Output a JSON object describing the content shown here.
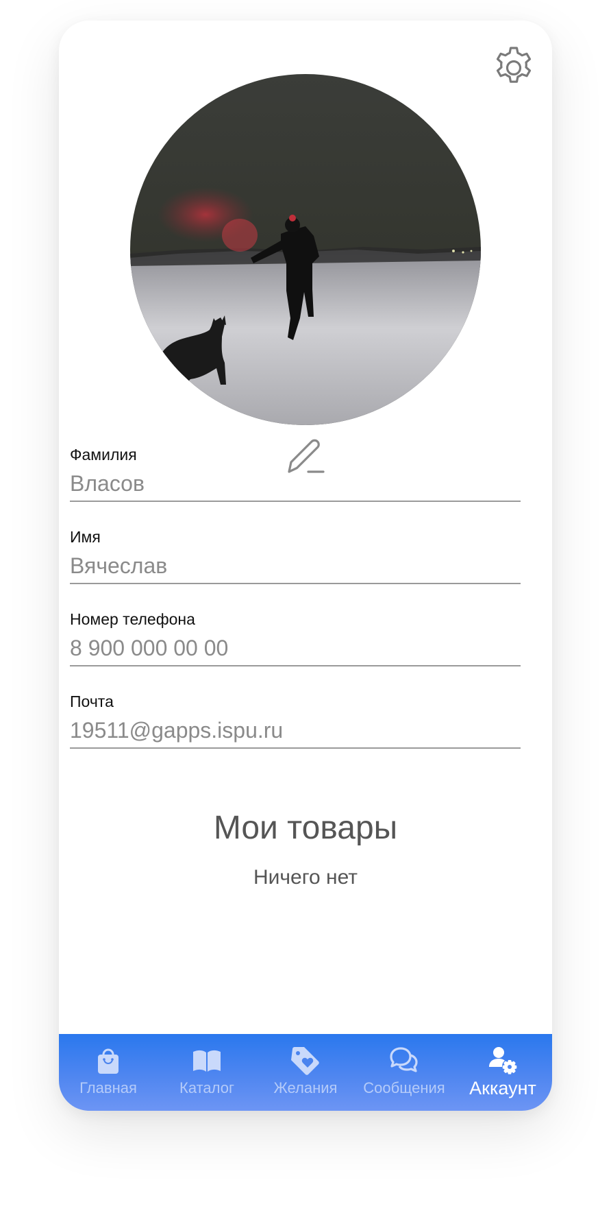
{
  "profile": {
    "photo_alt": "аватар пользователя"
  },
  "fields": [
    {
      "label": "Фамилия",
      "placeholder": "Власов"
    },
    {
      "label": "Имя",
      "placeholder": "Вячеслав"
    },
    {
      "label": "Номер телефона",
      "placeholder": "8 900 000 00 00"
    },
    {
      "label": "Почта",
      "placeholder": "19511@gapps.ispu.ru"
    }
  ],
  "products": {
    "title": "Мои товары",
    "empty_text": "Ничего нет"
  },
  "nav": {
    "items": [
      {
        "label": "Главная",
        "icon": "shopping-bag-icon",
        "active": false
      },
      {
        "label": "Каталог",
        "icon": "book-icon",
        "active": false
      },
      {
        "label": "Желания",
        "icon": "heart-tag-icon",
        "active": false
      },
      {
        "label": "Сообщения",
        "icon": "chat-bubbles-icon",
        "active": false
      },
      {
        "label": "Аккаунт",
        "icon": "user-gear-icon",
        "active": true
      }
    ]
  },
  "colors": {
    "nav_background": "#3a7ff0",
    "nav_inactive": "#c9d9fb",
    "nav_active": "#ffffff",
    "field_text": "#8a8a8a",
    "label_text": "#111111",
    "heading_text": "#555555"
  },
  "icons": {
    "settings": "gear-icon",
    "edit": "pencil-icon"
  }
}
